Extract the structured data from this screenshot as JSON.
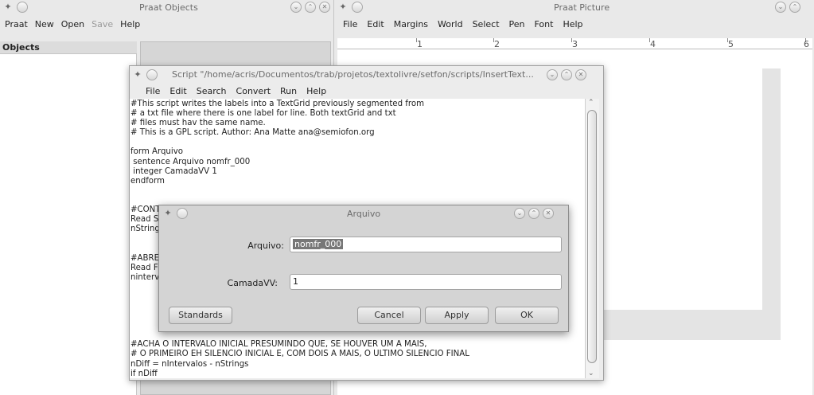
{
  "objects_window": {
    "title": "Praat Objects",
    "menu": [
      "Praat",
      "New",
      "Open",
      "Save",
      "Help"
    ],
    "disabled_menu_index": 3,
    "list_header": "Objects"
  },
  "picture_window": {
    "title": "Praat Picture",
    "menu": [
      "File",
      "Edit",
      "Margins",
      "World",
      "Select",
      "Pen",
      "Font",
      "Help"
    ],
    "ruler_labels": [
      "1",
      "2",
      "3",
      "4",
      "5",
      "6"
    ]
  },
  "script_window": {
    "title": "Script \"/home/acris/Documentos/trab/projetos/textolivre/setfon/scripts/InsertText...",
    "menu": [
      "File",
      "Edit",
      "Search",
      "Convert",
      "Run",
      "Help"
    ],
    "lines": [
      "#This script writes the labels into a TextGrid previously segmented from",
      "# a txt file where there is one label for line. Both textGrid and txt",
      "# files must hav the same name.",
      "# This is a GPL script. Author: Ana Matte ana@semiofon.org",
      "",
      "form Arquivo",
      " sentence Arquivo nomfr_000",
      " integer CamadaVV 1",
      "endform",
      "",
      "",
      "#CONT",
      "Read S",
      "nString",
      "",
      "",
      "#ABRE",
      "Read F",
      "ninterv",
      "",
      "",
      "",
      "",
      "",
      "",
      "#ACHA O INTERVALO INICIAL PRESUMINDO QUE, SE HOUVER UM A MAIS,",
      "# O PRIMEIRO EH SILENCIO INICIAL E, COM DOIS A MAIS, O ULTIMO SILENCIO FINAL",
      "nDiff = nIntervalos - nStrings",
      "if nDiff"
    ]
  },
  "dialog": {
    "title": "Arquivo",
    "arquivo_label": "Arquivo:",
    "arquivo_value": "nomfr_000",
    "camada_label": "CamadaVV:",
    "camada_value": "1",
    "standards_label": "Standards",
    "cancel_label": "Cancel",
    "apply_label": "Apply",
    "ok_label": "OK"
  }
}
